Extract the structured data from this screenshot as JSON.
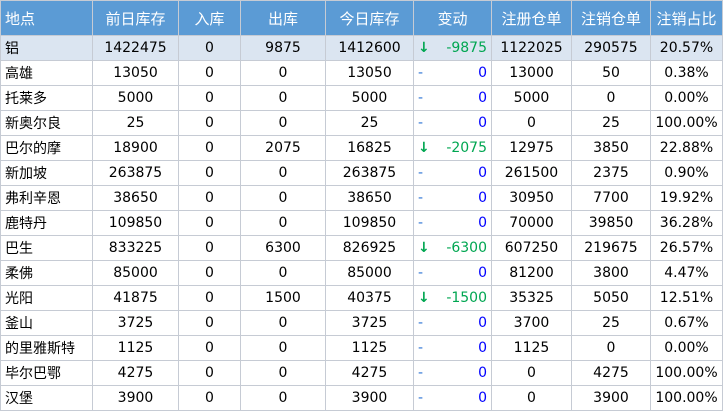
{
  "headers": [
    "地点",
    "前日库存",
    "入库",
    "出库",
    "今日库存",
    "变动",
    "注册仓单",
    "注销仓单",
    "注销占比"
  ],
  "rows": [
    {
      "place": "铝",
      "prev": "1422475",
      "in": "0",
      "out": "9875",
      "today": "1412600",
      "arrow": "↓",
      "dir": "down",
      "change": "-9875",
      "reg": "1122025",
      "cancel": "290575",
      "ratio": "20.57%"
    },
    {
      "place": "高雄",
      "prev": "13050",
      "in": "0",
      "out": "0",
      "today": "13050",
      "arrow": "-",
      "dir": "flat",
      "change": "0",
      "reg": "13000",
      "cancel": "50",
      "ratio": "0.38%"
    },
    {
      "place": "托莱多",
      "prev": "5000",
      "in": "0",
      "out": "0",
      "today": "5000",
      "arrow": "-",
      "dir": "flat",
      "change": "0",
      "reg": "5000",
      "cancel": "0",
      "ratio": "0.00%"
    },
    {
      "place": "新奥尔良",
      "prev": "25",
      "in": "0",
      "out": "0",
      "today": "25",
      "arrow": "-",
      "dir": "flat",
      "change": "0",
      "reg": "0",
      "cancel": "25",
      "ratio": "100.00%"
    },
    {
      "place": "巴尔的摩",
      "prev": "18900",
      "in": "0",
      "out": "2075",
      "today": "16825",
      "arrow": "↓",
      "dir": "down",
      "change": "-2075",
      "reg": "12975",
      "cancel": "3850",
      "ratio": "22.88%"
    },
    {
      "place": "新加坡",
      "prev": "263875",
      "in": "0",
      "out": "0",
      "today": "263875",
      "arrow": "-",
      "dir": "flat",
      "change": "0",
      "reg": "261500",
      "cancel": "2375",
      "ratio": "0.90%"
    },
    {
      "place": "弗利辛恩",
      "prev": "38650",
      "in": "0",
      "out": "0",
      "today": "38650",
      "arrow": "-",
      "dir": "flat",
      "change": "0",
      "reg": "30950",
      "cancel": "7700",
      "ratio": "19.92%"
    },
    {
      "place": "鹿特丹",
      "prev": "109850",
      "in": "0",
      "out": "0",
      "today": "109850",
      "arrow": "-",
      "dir": "flat",
      "change": "0",
      "reg": "70000",
      "cancel": "39850",
      "ratio": "36.28%"
    },
    {
      "place": "巴生",
      "prev": "833225",
      "in": "0",
      "out": "6300",
      "today": "826925",
      "arrow": "↓",
      "dir": "down",
      "change": "-6300",
      "reg": "607250",
      "cancel": "219675",
      "ratio": "26.57%"
    },
    {
      "place": "柔佛",
      "prev": "85000",
      "in": "0",
      "out": "0",
      "today": "85000",
      "arrow": "-",
      "dir": "flat",
      "change": "0",
      "reg": "81200",
      "cancel": "3800",
      "ratio": "4.47%"
    },
    {
      "place": "光阳",
      "prev": "41875",
      "in": "0",
      "out": "1500",
      "today": "40375",
      "arrow": "↓",
      "dir": "down",
      "change": "-1500",
      "reg": "35325",
      "cancel": "5050",
      "ratio": "12.51%"
    },
    {
      "place": "釜山",
      "prev": "3725",
      "in": "0",
      "out": "0",
      "today": "3725",
      "arrow": "-",
      "dir": "flat",
      "change": "0",
      "reg": "3700",
      "cancel": "25",
      "ratio": "0.67%"
    },
    {
      "place": "的里雅斯特",
      "prev": "1125",
      "in": "0",
      "out": "0",
      "today": "1125",
      "arrow": "-",
      "dir": "flat",
      "change": "0",
      "reg": "1125",
      "cancel": "0",
      "ratio": "0.00%"
    },
    {
      "place": "毕尔巴鄂",
      "prev": "4275",
      "in": "0",
      "out": "0",
      "today": "4275",
      "arrow": "-",
      "dir": "flat",
      "change": "0",
      "reg": "0",
      "cancel": "4275",
      "ratio": "100.00%"
    },
    {
      "place": "汉堡",
      "prev": "3900",
      "in": "0",
      "out": "0",
      "today": "3900",
      "arrow": "-",
      "dir": "flat",
      "change": "0",
      "reg": "0",
      "cancel": "3900",
      "ratio": "100.00%"
    }
  ],
  "colors": {
    "header_bg": "#5b9bd5",
    "header_text": "#ffffff",
    "total_row_bg": "#dbe5f1",
    "down_arrow": "#00a651",
    "negative_change": "#00a651",
    "zero_change": "#0000ff",
    "flat_dash": "#2e74d6"
  }
}
